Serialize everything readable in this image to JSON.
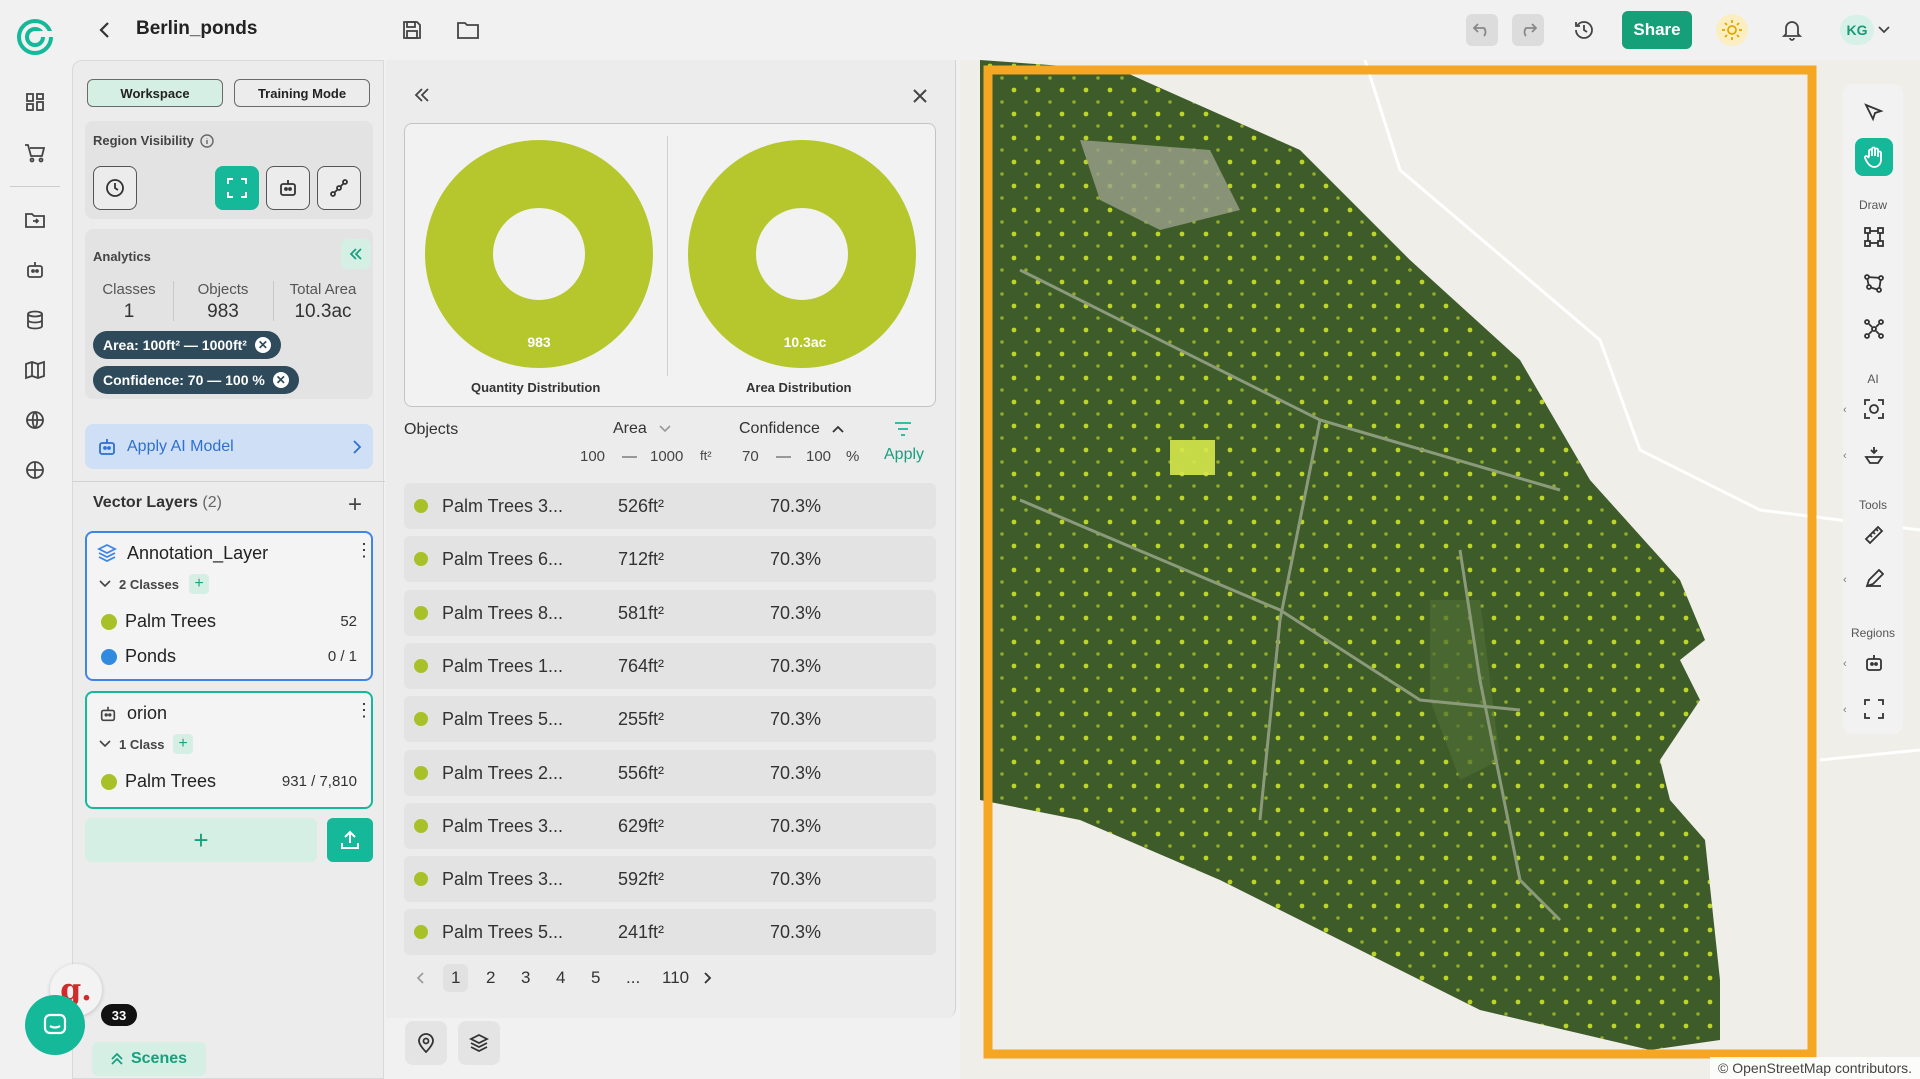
{
  "project": {
    "title": "Berlin_ponds"
  },
  "header": {
    "share_label": "Share",
    "avatar_initials": "KG"
  },
  "left_panel": {
    "tabs": {
      "workspace": "Workspace",
      "training_mode": "Training Mode"
    },
    "region_visibility_label": "Region Visibility",
    "analytics": {
      "title": "Analytics",
      "classes_label": "Classes",
      "classes_value": "1",
      "objects_label": "Objects",
      "objects_value": "983",
      "area_label": "Total Area",
      "area_value": "10.3ac",
      "filter_area": "Area:  100ft² — 1000ft²",
      "filter_confidence": "Confidence:  70 — 100 %"
    },
    "apply_ai_label": "Apply AI Model",
    "vector_layers": {
      "title": "Vector Layers",
      "count": "(2)",
      "layers": [
        {
          "name": "Annotation_Layer",
          "classes_label": "2 Classes",
          "items": [
            {
              "label": "Palm Trees",
              "count": "52",
              "color": "#a8c128"
            },
            {
              "label": "Ponds",
              "count": "0 / 1",
              "color": "#2f8ae0"
            }
          ]
        },
        {
          "name": "orion",
          "classes_label": "1 Class",
          "items": [
            {
              "label": "Palm Trees",
              "count": "931 / 7,810",
              "color": "#a8c128"
            }
          ]
        }
      ]
    },
    "add_button_label": "+"
  },
  "middle_panel": {
    "charts": [
      {
        "label": "Quantity Distribution",
        "center_value": "983",
        "color": "#b6c72e"
      },
      {
        "label": "Area Distribution",
        "center_value": "10.3ac",
        "color": "#b6c72e"
      }
    ],
    "table": {
      "col_objects": "Objects",
      "col_area": "Area",
      "col_confidence": "Confidence",
      "area_min": "100",
      "area_max": "1000",
      "area_unit": "ft²",
      "conf_min": "70",
      "conf_max": "100",
      "conf_unit": "%",
      "dash": "—",
      "apply_label": "Apply",
      "rows": [
        {
          "name": "Palm Trees 3...",
          "area": "526ft²",
          "conf": "70.3%"
        },
        {
          "name": "Palm Trees 6...",
          "area": "712ft²",
          "conf": "70.3%"
        },
        {
          "name": "Palm Trees 8...",
          "area": "581ft²",
          "conf": "70.3%"
        },
        {
          "name": "Palm Trees 1...",
          "area": "764ft²",
          "conf": "70.3%"
        },
        {
          "name": "Palm Trees 5...",
          "area": "255ft²",
          "conf": "70.3%"
        },
        {
          "name": "Palm Trees 2...",
          "area": "556ft²",
          "conf": "70.3%"
        },
        {
          "name": "Palm Trees 3...",
          "area": "629ft²",
          "conf": "70.3%"
        },
        {
          "name": "Palm Trees 3...",
          "area": "592ft²",
          "conf": "70.3%"
        },
        {
          "name": "Palm Trees 5...",
          "area": "241ft²",
          "conf": "70.3%"
        }
      ]
    },
    "pagination": {
      "pages": [
        "1",
        "2",
        "3",
        "4",
        "5",
        "...",
        "110"
      ],
      "current": "1"
    }
  },
  "right_toolbar": {
    "draw_label": "Draw",
    "ai_label": "AI",
    "tools_label": "Tools",
    "regions_label": "Regions"
  },
  "map": {
    "attribution": "© OpenStreetMap contributors.",
    "highlight_color": "#f5a623"
  },
  "bottom": {
    "notif_count": "33",
    "scenes_label": "Scenes",
    "brand_letter": "g."
  }
}
